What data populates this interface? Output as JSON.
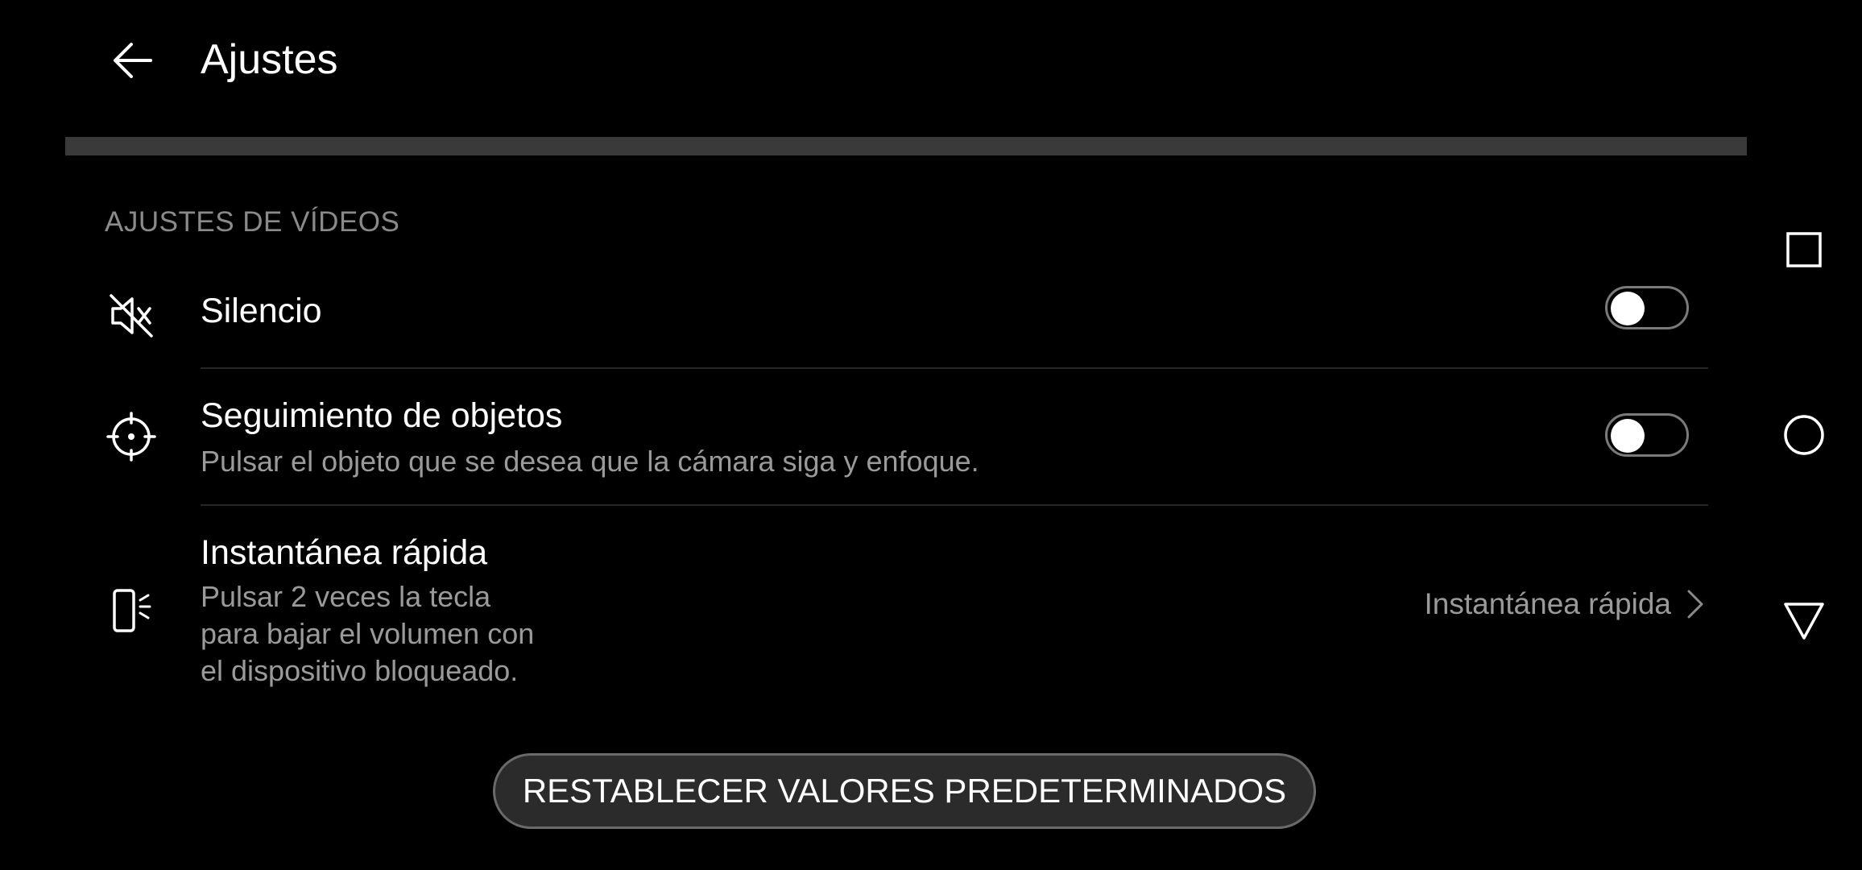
{
  "header": {
    "title": "Ajustes",
    "back_icon": "arrow-left-icon"
  },
  "section": {
    "title": "AJUSTES DE VÍDEOS"
  },
  "settings": [
    {
      "icon": "speaker-muted-icon",
      "title": "Silencio",
      "subtitle": "",
      "control": "toggle",
      "enabled": false
    },
    {
      "icon": "crosshair-target-icon",
      "title": "Seguimiento de objetos",
      "subtitle": "Pulsar el objeto que se desea que la cámara siga y enfoque.",
      "control": "toggle",
      "enabled": false
    },
    {
      "icon": "phone-volume-key-icon",
      "title": "Instantánea rápida",
      "subtitle_lines": [
        "Pulsar 2 veces la tecla",
        "para bajar el volumen con",
        "el dispositivo bloqueado."
      ],
      "control": "link",
      "value": "Instantánea rápida",
      "value_icon": "chevron-right-icon"
    }
  ],
  "reset_button": {
    "label": "RESTABLECER VALORES PREDETERMINADOS"
  },
  "nav": {
    "recent_icon": "square-recents-icon",
    "home_icon": "circle-home-icon",
    "back_icon": "triangle-back-icon"
  },
  "colors": {
    "background": "#000000",
    "primary_text": "#ffffff",
    "secondary_text": "#9a9a9a",
    "divider": "#3a3a3a",
    "toggle_border": "#7a7a7a"
  }
}
